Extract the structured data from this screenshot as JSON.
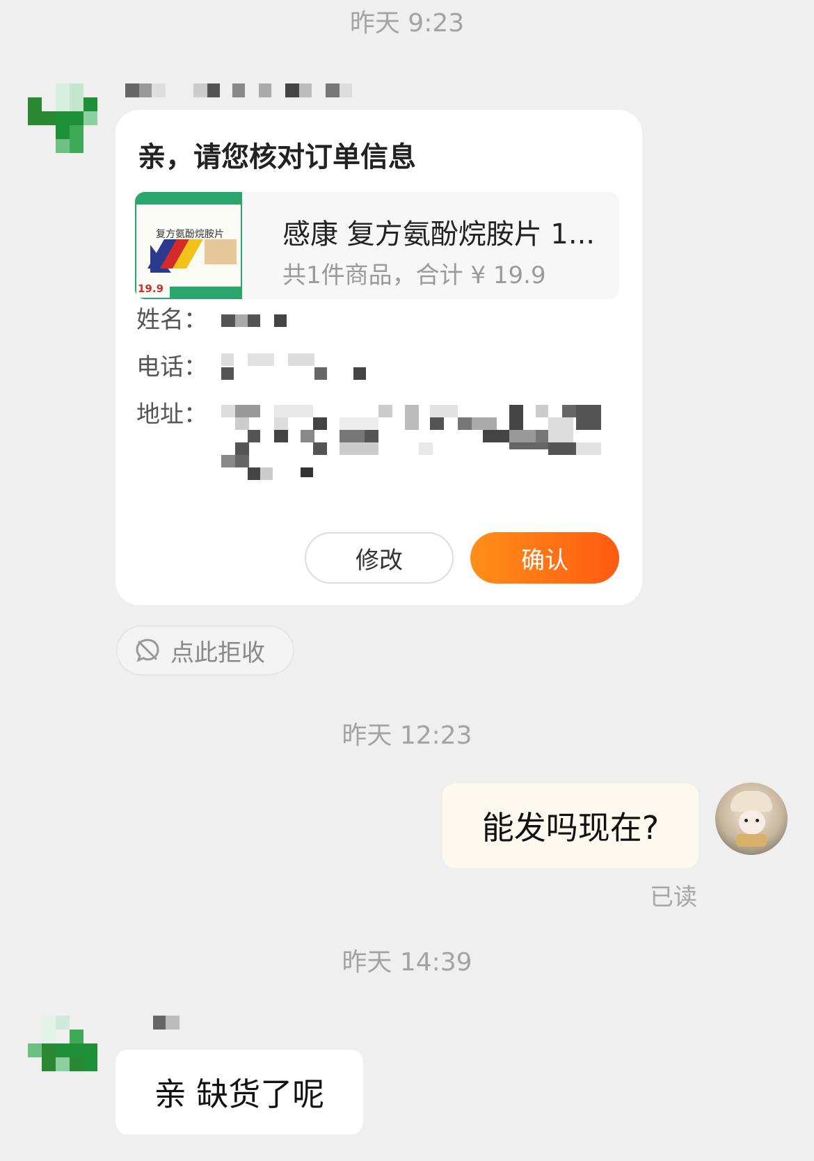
{
  "timestamps": [
    "昨天 9:23",
    "昨天 12:23",
    "昨天 14:39"
  ],
  "order_card": {
    "title": "亲，请您核对订单信息",
    "product_name": "感康 复方氨酚烷胺片 1...",
    "product_summary": "共1件商品，合计 ¥ 19.9",
    "product_image_text": "复方氨酚烷胺片",
    "product_image_price": "19.9",
    "name_label": "姓名：",
    "phone_label": "电话：",
    "address_label": "地址：",
    "edit_label": "修改",
    "confirm_label": "确认"
  },
  "reject": {
    "label": "点此拒收",
    "icon": "no-message-icon"
  },
  "my_message": {
    "text": "能发吗现在?",
    "status": "已读"
  },
  "shop_message": {
    "text": "亲 缺货了呢"
  },
  "colors": {
    "background": "#efefef",
    "accent_start": "#ff8f18",
    "accent_end": "#ff5a12",
    "my_bubble": "#fdf9ee",
    "avatar_green": "#1f9a3f"
  }
}
